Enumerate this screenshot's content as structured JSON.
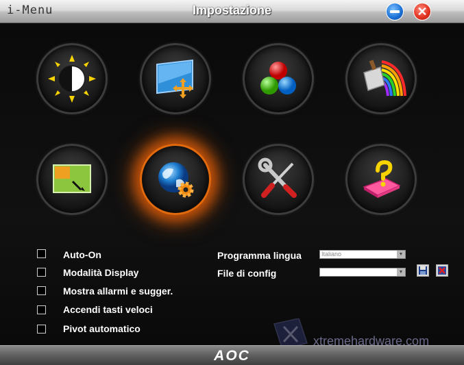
{
  "window": {
    "app_name": "i-Menu",
    "title": "Impostazione",
    "minimize_label": "",
    "close_label": "✕",
    "brand": "AOC"
  },
  "icons": [
    {
      "name": "brightness-icon"
    },
    {
      "name": "image-setup-icon"
    },
    {
      "name": "color-setup-icon"
    },
    {
      "name": "picture-boost-icon"
    },
    {
      "name": "osd-setup-icon"
    },
    {
      "name": "extra-settings-icon",
      "active": true
    },
    {
      "name": "tools-icon"
    },
    {
      "name": "reset-icon"
    }
  ],
  "options": [
    {
      "label": "Auto-On",
      "checked": false
    },
    {
      "label": "Modalità Display",
      "checked": false
    },
    {
      "label": "Mostra allarmi e sugger.",
      "checked": false
    },
    {
      "label": "Accendi tasti veloci",
      "checked": false
    },
    {
      "label": "Pivot automatico",
      "checked": false
    }
  ],
  "language": {
    "label": "Programma lingua",
    "value": "Italiano"
  },
  "config": {
    "label": "File di config",
    "value": ""
  },
  "watermark": {
    "text": "xtremehardware.com"
  },
  "colors": {
    "accent": "#e36a0c",
    "background": "#0d0d0d"
  }
}
